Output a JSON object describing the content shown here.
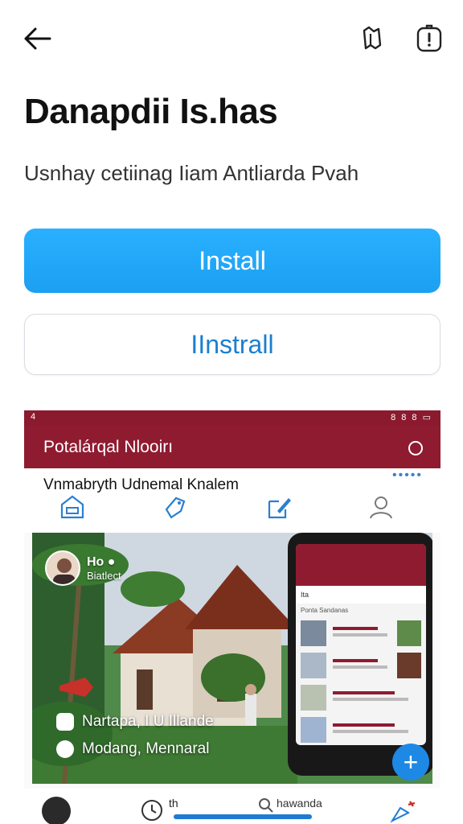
{
  "header": {
    "back_icon": "arrow-left-icon",
    "share_icon": "share-icon",
    "report_icon": "report-icon"
  },
  "app": {
    "title": "Danapdii Is.has",
    "subtitle": "Usnhay cetiinag Iiam Antliarda Pvah"
  },
  "buttons": {
    "install_primary": "Install",
    "install_secondary": "IInstrall"
  },
  "colors": {
    "accent_blue": "#1ba0f2",
    "app_maroon": "#8f1b31",
    "fab_blue": "#1e88e5"
  },
  "screenshot": {
    "status_left": "4",
    "status_right": "8 8 8 ▭",
    "appbar_title": "Potalárqal Nlooirı",
    "tabs_caption": "Vnmabryth Udnemal Knalem",
    "tabs_dots": "•••••",
    "hero": {
      "user_name": "Ho ●",
      "user_sub": "Biatlect",
      "caption1": "Nartapa,  I U Illande",
      "caption2": "Modang, Mennaral"
    },
    "phone": {
      "sub": "Ita",
      "head": "Ponta Sandanas"
    },
    "fab_label": "+",
    "bottom_nav": {
      "label1": "th",
      "label2": "hawanda"
    }
  }
}
